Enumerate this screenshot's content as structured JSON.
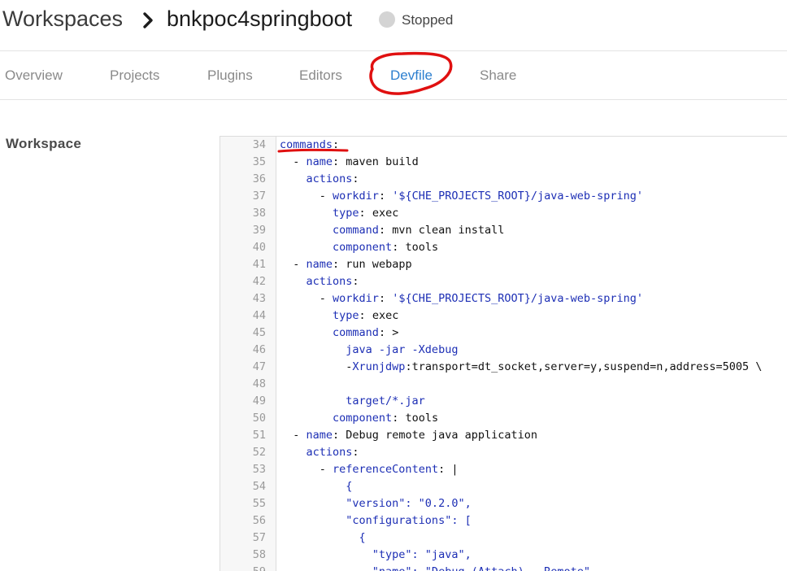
{
  "breadcrumb": {
    "root": "Workspaces",
    "workspace": "bnkpoc4springboot"
  },
  "status": {
    "text": "Stopped",
    "color": "#d4d4d4"
  },
  "tabs": [
    {
      "label": "Overview",
      "active": false
    },
    {
      "label": "Projects",
      "active": false
    },
    {
      "label": "Plugins",
      "active": false
    },
    {
      "label": "Editors",
      "active": false
    },
    {
      "label": "Devfile",
      "active": true
    },
    {
      "label": "Share",
      "active": false
    }
  ],
  "sidebar": {
    "section_label": "Workspace"
  },
  "colors": {
    "accent": "#2d7fcf",
    "annotation": "#e01010",
    "code_keyword": "#1d2fb5"
  },
  "editor": {
    "lines": [
      {
        "n": "34",
        "text": "commands:"
      },
      {
        "n": "35",
        "text": "  - name: maven build"
      },
      {
        "n": "36",
        "text": "    actions:"
      },
      {
        "n": "37",
        "text": "      - workdir: '${CHE_PROJECTS_ROOT}/java-web-spring'"
      },
      {
        "n": "38",
        "text": "        type: exec"
      },
      {
        "n": "39",
        "text": "        command: mvn clean install"
      },
      {
        "n": "40",
        "text": "        component: tools"
      },
      {
        "n": "41",
        "text": "  - name: run webapp"
      },
      {
        "n": "42",
        "text": "    actions:"
      },
      {
        "n": "43",
        "text": "      - workdir: '${CHE_PROJECTS_ROOT}/java-web-spring'"
      },
      {
        "n": "44",
        "text": "        type: exec"
      },
      {
        "n": "45",
        "text": "        command: >"
      },
      {
        "n": "46",
        "text": "          java -jar -Xdebug"
      },
      {
        "n": "47",
        "text": "          -Xrunjdwp:transport=dt_socket,server=y,suspend=n,address=5005 \\"
      },
      {
        "n": "48",
        "text": ""
      },
      {
        "n": "49",
        "text": "          target/*.jar"
      },
      {
        "n": "50",
        "text": "        component: tools"
      },
      {
        "n": "51",
        "text": "  - name: Debug remote java application"
      },
      {
        "n": "52",
        "text": "    actions:"
      },
      {
        "n": "53",
        "text": "      - referenceContent: |"
      },
      {
        "n": "54",
        "text": "          {"
      },
      {
        "n": "55",
        "text": "          \"version\": \"0.2.0\","
      },
      {
        "n": "56",
        "text": "          \"configurations\": ["
      },
      {
        "n": "57",
        "text": "            {"
      },
      {
        "n": "58",
        "text": "              \"type\": \"java\","
      },
      {
        "n": "59",
        "text": "              \"name\": \"Debug (Attach) - Remote\","
      }
    ]
  }
}
